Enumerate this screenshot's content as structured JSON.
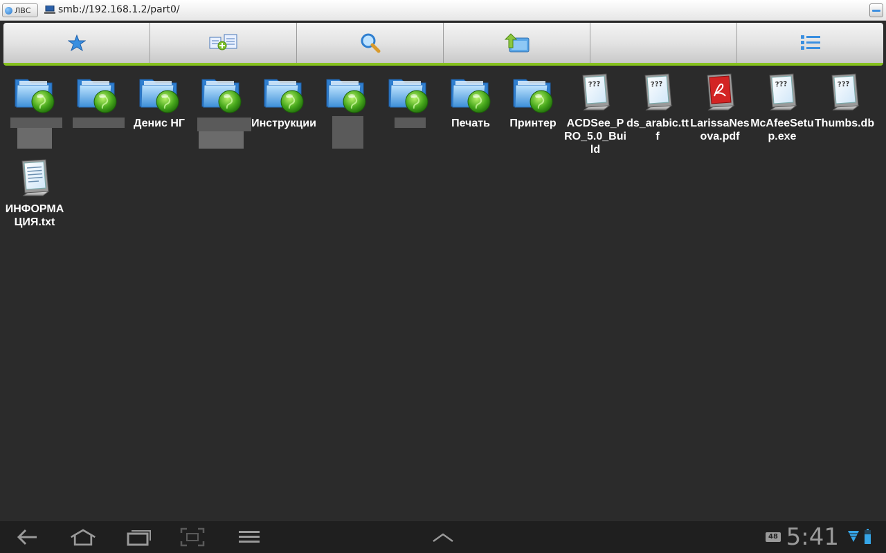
{
  "address_bar": {
    "network_button_label": "ЛВС",
    "path": "smb://192.168.1.2/part0/"
  },
  "toolbar": {
    "buttons": [
      "favorites",
      "copy-to",
      "search",
      "up-folder",
      "empty",
      "view-list"
    ]
  },
  "items": [
    {
      "name": "",
      "type": "network-folder",
      "redacted": true
    },
    {
      "name": "",
      "type": "network-folder",
      "redacted": true
    },
    {
      "name": "Денис НГ",
      "type": "network-folder"
    },
    {
      "name": "",
      "type": "network-folder",
      "redacted": true
    },
    {
      "name": "Инструкции",
      "type": "network-folder"
    },
    {
      "name": "",
      "type": "network-folder",
      "redacted": true
    },
    {
      "name": "",
      "type": "network-folder",
      "redacted": true
    },
    {
      "name": "Печать",
      "type": "network-folder"
    },
    {
      "name": "Принтер",
      "type": "network-folder"
    },
    {
      "name": "ACDSee_PRO_5.0_Build",
      "type": "unknown-file"
    },
    {
      "name": "ds_arabic.ttf",
      "type": "unknown-file"
    },
    {
      "name": "LarissaNesova.pdf",
      "type": "pdf-file"
    },
    {
      "name": "McAfeeSetup.exe",
      "type": "unknown-file"
    },
    {
      "name": "Thumbs.db",
      "type": "unknown-file"
    },
    {
      "name": "ИНФОРМАЦИЯ.txt",
      "type": "text-file"
    }
  ],
  "status": {
    "notification_badge": "48",
    "time": "5:41"
  },
  "colors": {
    "accent": "#86c21e",
    "background": "#2b2b2b"
  }
}
